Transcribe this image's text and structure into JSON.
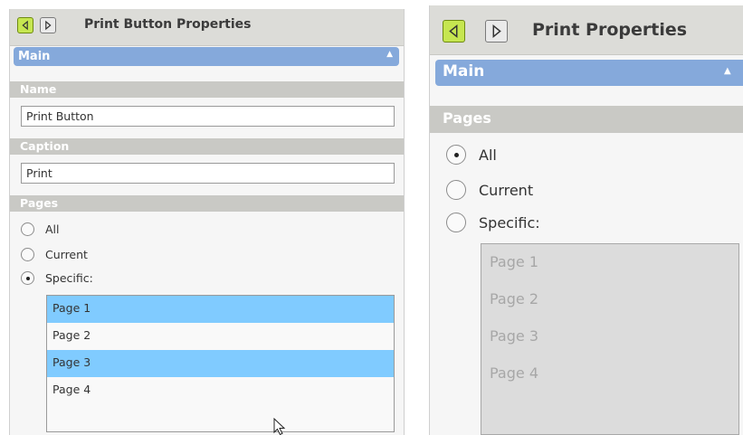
{
  "left_panel": {
    "title": "Print Button Properties",
    "back_icon": "arrow-left-icon",
    "forward_icon": "arrow-right-icon",
    "main_section": "Main",
    "collapse_icon": "triangle-up-icon",
    "name_label": "Name",
    "name_value": "Print Button",
    "caption_label": "Caption",
    "caption_value": "Print",
    "pages_label": "Pages",
    "page_options": [
      {
        "label": "All",
        "selected": false
      },
      {
        "label": "Current",
        "selected": false
      },
      {
        "label": "Specific:",
        "selected": true
      }
    ],
    "page_list": [
      {
        "label": "Page 1",
        "selected": true
      },
      {
        "label": "Page 2",
        "selected": false
      },
      {
        "label": "Page 3",
        "selected": true
      },
      {
        "label": "Page 4",
        "selected": false
      }
    ]
  },
  "right_panel": {
    "title": "Print Properties",
    "back_icon": "arrow-left-icon",
    "forward_icon": "arrow-right-icon",
    "main_section": "Main",
    "collapse_icon": "triangle-up-icon",
    "pages_label": "Pages",
    "page_options": [
      {
        "label": "All",
        "selected": true
      },
      {
        "label": "Current",
        "selected": false
      },
      {
        "label": "Specific:",
        "selected": false
      }
    ],
    "page_list_disabled": true,
    "page_list": [
      {
        "label": "Page 1"
      },
      {
        "label": "Page 2"
      },
      {
        "label": "Page 3"
      },
      {
        "label": "Page 4"
      }
    ]
  },
  "colors": {
    "accent_blue": "#85a9db",
    "selection_blue": "#80cbff",
    "back_button_green": "#c6e650",
    "section_header_gray": "#c9c9c5",
    "disabled_list_bg": "#dcdcdc",
    "disabled_text": "#a7a7a7"
  },
  "cursor_icon": "mouse-pointer-icon"
}
